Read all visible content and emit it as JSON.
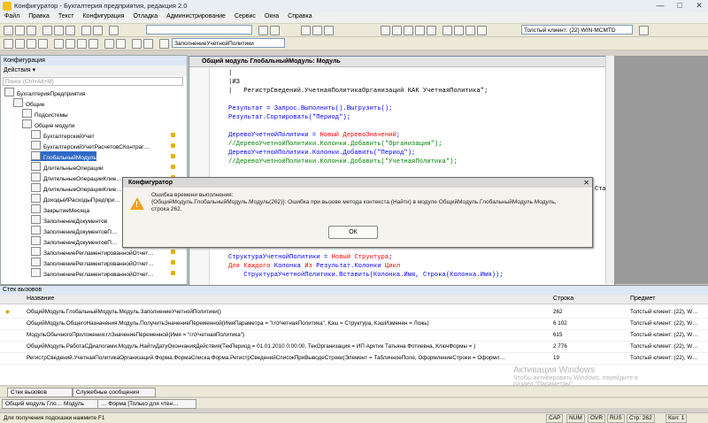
{
  "window": {
    "title": "Конфигуратор - Бухгалтерия предприятия, редакция 2.0",
    "buttons": [
      "—",
      "□",
      "✕"
    ]
  },
  "menu": [
    "Файл",
    "Правка",
    "Текст",
    "Конфигурация",
    "Отладка",
    "Администрирование",
    "Сервис",
    "Окна",
    "Справка"
  ],
  "toolbar": {
    "proc_combo": "ЗаполнениеУчетнойПолитики",
    "client_combo": "Толстый клиент: (22) WIN-MCMTD"
  },
  "left_panel": {
    "title": "Конфигурация",
    "actions": "Действия ▾",
    "search_placeholder": "Поиск (Ctrl+Alt+M)",
    "items": [
      {
        "label": "БухгалтерияПредприятия",
        "indent": 0,
        "lock": false
      },
      {
        "label": "Общие",
        "indent": 1,
        "lock": false
      },
      {
        "label": "Подсистемы",
        "indent": 2,
        "lock": false
      },
      {
        "label": "Общие модули",
        "indent": 2,
        "lock": false
      },
      {
        "label": "БухгалтерскийУчет",
        "indent": 3,
        "lock": true
      },
      {
        "label": "БухгалтерскийУчетРасчетовСКонтраг…",
        "indent": 3,
        "lock": true
      },
      {
        "label": "ГлобальныйМодуль",
        "indent": 3,
        "lock": true,
        "selected": true
      },
      {
        "label": "ДлительныеОперации",
        "indent": 3,
        "lock": true
      },
      {
        "label": "ДлительныеОперацииКлие…",
        "indent": 3,
        "lock": true
      },
      {
        "label": "ДлительныеОперацииКлие…",
        "indent": 3,
        "lock": true
      },
      {
        "label": "ДоходыИРасходыПредпри…",
        "indent": 3,
        "lock": true
      },
      {
        "label": "ЗакрытиеМесяца",
        "indent": 3,
        "lock": true
      },
      {
        "label": "ЗаполнениеДокументов",
        "indent": 3,
        "lock": true
      },
      {
        "label": "ЗаполнениеДокументовП…",
        "indent": 3,
        "lock": true
      },
      {
        "label": "ЗаполнениеДокументовП…",
        "indent": 3,
        "lock": true
      },
      {
        "label": "ЗаполнениеРегламентированнойОтчет…",
        "indent": 3,
        "lock": true
      },
      {
        "label": "ЗаполнениеРегламентированнойОтчет…",
        "indent": 3,
        "lock": true
      },
      {
        "label": "ЗаполнениеРегламентированнойОтчет…",
        "indent": 3,
        "lock": true
      }
    ]
  },
  "code_window": {
    "title": "Общий модуль ГлобальныйМодуль: Модуль",
    "lines": [
      [
        {
          "t": "|",
          "c": "plain"
        }
      ],
      [
        {
          "t": "|ИЗ",
          "c": "plain"
        }
      ],
      [
        {
          "t": "|   РегистрСведений.УчетнаяПолитикаОрганизаций КАК УчетнаяПолитика\";",
          "c": "plain"
        }
      ],
      [
        {
          "t": "",
          "c": "plain"
        }
      ],
      [
        {
          "t": "Результат = Запрос.Выполнить().Выгрузить();",
          "c": "id"
        }
      ],
      [
        {
          "t": "Результат.Сортировать(\"Период\");",
          "c": "id"
        }
      ],
      [
        {
          "t": "",
          "c": "plain"
        }
      ],
      [
        {
          "t": "ДеревоУчетнойПолитики = ",
          "c": "id"
        },
        {
          "t": "Новый ДеревоЗначений",
          "c": "kw"
        },
        {
          "t": ";",
          "c": "id"
        }
      ],
      [
        {
          "t": "//ДеревоУчетнойПолитики.Колонки.Добавить(\"Организация\");",
          "c": "cm"
        }
      ],
      [
        {
          "t": "ДеревоУчетнойПолитики.Колонки.Добавить(\"Период\");",
          "c": "id"
        }
      ],
      [
        {
          "t": "//ДеревоУчетнойПолитики.Колонки.Добавить(\"УчетнаяПолитика\");",
          "c": "cm"
        }
      ]
    ],
    "lines_bottom": [
      [
        {
          "t": "СтруктураУчетнойПолитики = ",
          "c": "id"
        },
        {
          "t": "Новый Структура",
          "c": "kw"
        },
        {
          "t": ";",
          "c": "id"
        }
      ],
      [
        {
          "t": "Для Каждого",
          "c": "kw"
        },
        {
          "t": " Колонка ",
          "c": "id"
        },
        {
          "t": "Из",
          "c": "kw"
        },
        {
          "t": " Результат.Колонки ",
          "c": "id"
        },
        {
          "t": "Цикл",
          "c": "kw"
        }
      ],
      [
        {
          "t": "    СтруктураУчетнойПолитики.Вставить(Колонка.Имя, Строка(Колонка.Имя));",
          "c": "id"
        }
      ]
    ],
    "side_fragment": "Стац"
  },
  "dialog": {
    "title": "Конфигуратор",
    "message_line1": "Ошибка времени выполнения:",
    "message_line2": "{ОбщийМодуль.ГлобальныйМодуль.Модуль(262)}: Ошибка при вызове метода контекста (Найти) в модуле ОбщийМодуль.ГлобальныйМодуль.Модуль,",
    "message_line3": "строка 262.",
    "ok_label": "ОК"
  },
  "call_stack": {
    "title": "Стек вызовов",
    "columns": [
      "Название",
      "Строка",
      "Предмет"
    ],
    "rows": [
      {
        "name": "ОбщийМодуль.ГлобальныйМодуль.Модуль.ЗаполнениеУчетнойПолитики()",
        "line": "262",
        "subject": "Толстый клиент: (22), W…"
      },
      {
        "name": "ОбщийМодуль.ОбщегоНазначения.Модуль.ПолучитьЗначениеПеременной(ИмяПараметра = \"глУчетнаяПолитика\", Кэш = Структура, КэшИзменен = Ложь)",
        "line": "6 102",
        "subject": "Толстый клиент: (22), W…"
      },
      {
        "name": "МодульОбычногоПриложения.глЗначениеПеременной(Имя = \"глУчетнаяПолитика\")",
        "line": "615",
        "subject": "Толстый клиент: (22), W…"
      },
      {
        "name": "ОбщийМодуль.РаботаСДиалогами.Модуль.НайтиДатуОкончанияДействия(ТекПериод = 01.01.2010 0:00:00, ТекОрганизация = ИП Арктик Татьяна Фотиевна, КлючФормы = )",
        "line": "2 776",
        "subject": "Толстый клиент: (22), W…"
      },
      {
        "name": "РегистрСведений.УчетнаяПолитикаОрганизаций.Форма.ФормаСписка.Форма.РегистрСведенийСписокПриВыводеСтроки(Элемент = ТабличноеПоле, ОформлениеСтроки = Оформл…",
        "line": "19",
        "subject": "Толстый клиент: (22), W…"
      }
    ]
  },
  "bottom_tabs": [
    "Стек вызовов",
    "Служебные сообщения"
  ],
  "window_tabs": [
    "Общий модуль Гло… Модуль",
    "… Форма [Только для чтен…"
  ],
  "status": {
    "hint": "Для получения подсказки нажмите F1",
    "cap": "CAP",
    "num": "NUM",
    "ovr": "OVR",
    "lang": "RUS",
    "line": "Стр: 262",
    "col": "Кол: 1"
  },
  "watermark": {
    "line1": "Активация Windows",
    "line2": "Чтобы активировать Windows, перейдите в",
    "line3": "раздел \"Параметры\"."
  }
}
